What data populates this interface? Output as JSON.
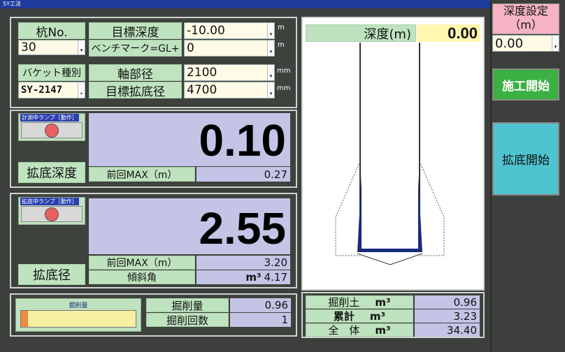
{
  "window": {
    "title": "SY工法"
  },
  "pile": {
    "label": "杭No.",
    "value": "30"
  },
  "target_depth": {
    "label": "目標深度",
    "value": "-10.00",
    "unit": "m"
  },
  "benchmark": {
    "label": "ベンチマーク=GL+",
    "value": "0",
    "unit": "m"
  },
  "bucket_type": {
    "label": "バケット種別",
    "value": "SY-2147"
  },
  "shaft_diameter": {
    "label": "軸部径",
    "value": "2100",
    "unit": "mm"
  },
  "target_enlarged_diameter": {
    "label": "目標拡底径",
    "value": "4700",
    "unit": "mm"
  },
  "measure_lamp": {
    "label": "計測中ランプ［動作］"
  },
  "enlarged_depth": {
    "label": "拡底深度",
    "value": "0.10",
    "prev_label": "前回MAX（m）",
    "prev_value": "0.27"
  },
  "enlarge_lamp": {
    "label": "拡底中ランプ［動作］"
  },
  "enlarged_diameter": {
    "label": "拡底径",
    "value": "2.55",
    "prev_label": "前回MAX（m）",
    "prev_value": "3.20",
    "tilt_label": "傾斜角",
    "tilt_unit": "m³",
    "tilt_value": "4.17"
  },
  "excavation": {
    "bar_label": "掘削量",
    "bar_fraction": 0.06,
    "colors": {
      "bar_fill": "#f08a3c",
      "bar_bg": "#f7f0a0"
    },
    "volume_label": "掘削量",
    "volume_value": "0.96",
    "count_label": "掘削回数",
    "count_value": "1"
  },
  "totals": {
    "soil_label": "掘削土",
    "soil_unit": "m³",
    "soil_value": "0.96",
    "cumulative_label": "累計",
    "cumulative_unit": "m³",
    "cumulative_value": "3.23",
    "overall_label": "全　体",
    "overall_unit": "m³",
    "overall_value": "34.40"
  },
  "depth_display": {
    "label": "深度(m)",
    "value": "0.00"
  },
  "depth_setting": {
    "label_line1": "深度設定",
    "label_line2": "（m）",
    "value": "0.00"
  },
  "buttons": {
    "start_construction": "施工開始",
    "start_enlargement": "拡底開始"
  },
  "colors": {
    "label_green": "#bfe3bf",
    "value_purple": "#c4c4e6",
    "button_green": "#3cb043",
    "button_cyan": "#4fc3cf",
    "setting_pink": "#f5b3c3",
    "pile_outline": "#1a2a7a"
  }
}
